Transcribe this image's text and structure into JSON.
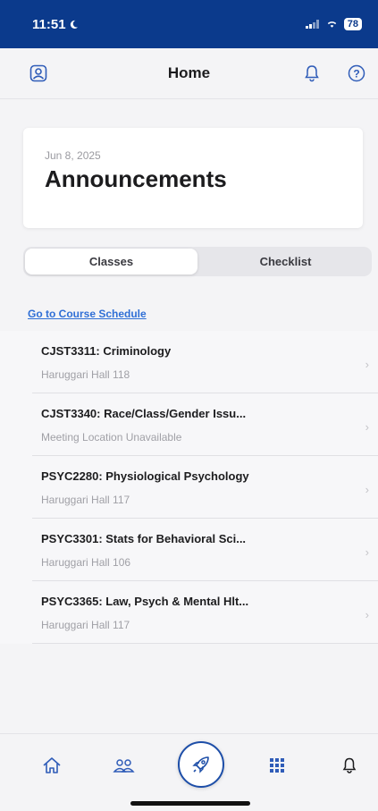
{
  "status_bar": {
    "time": "11:51",
    "battery": "78"
  },
  "header": {
    "title": "Home",
    "left_icon": "profile-icon",
    "right_icons": [
      "bell-icon",
      "help-icon"
    ]
  },
  "announcements": {
    "date": "Jun 8, 2025",
    "title": "Announcements"
  },
  "tabs": [
    {
      "label": "Classes",
      "active": true
    },
    {
      "label": "Checklist",
      "active": false
    }
  ],
  "schedule_link": "Go to Course Schedule",
  "courses": [
    {
      "name": "CJST3311: Criminology",
      "location": "Haruggari Hall 118"
    },
    {
      "name": "CJST3340: Race/Class/Gender Issu...",
      "location": "Meeting Location Unavailable"
    },
    {
      "name": "PSYC2280: Physiological Psychology",
      "location": "Haruggari Hall 117"
    },
    {
      "name": "PSYC3301: Stats for Behavioral Sci...",
      "location": "Haruggari Hall 106"
    },
    {
      "name": "PSYC3365: Law, Psych & Mental Hlt...",
      "location": "Haruggari Hall 117"
    }
  ],
  "tab_bar": {
    "items": [
      "home-icon",
      "people-icon",
      "rocket-icon",
      "grid-icon",
      "bell-icon"
    ]
  },
  "colors": {
    "status_bar": "#0b3a8c",
    "accent": "#1d4ea8",
    "link": "#2f6fd6"
  }
}
